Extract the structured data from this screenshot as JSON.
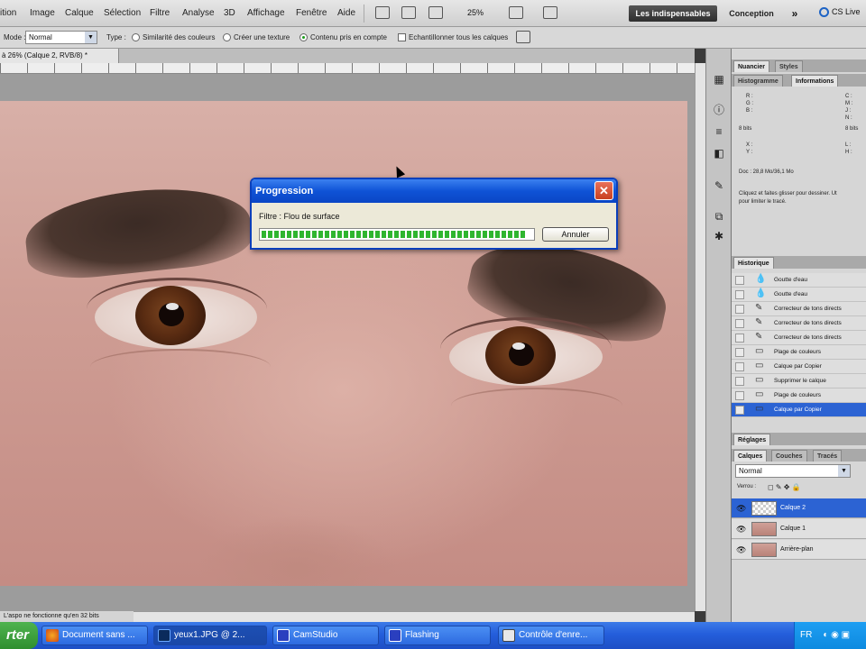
{
  "menu": {
    "items": [
      "ition",
      "Image",
      "Calque",
      "Sélection",
      "Filtre",
      "Analyse",
      "3D",
      "Affichage",
      "Fenêtre",
      "Aide"
    ],
    "zoom": "25%",
    "workspace_active": "Les indispensables",
    "workspace_other": "Conception",
    "more": "»",
    "cslive": "CS Live"
  },
  "options": {
    "mode_label": "Mode :",
    "mode_value": "Normal",
    "type_label": "Type :",
    "radio_1": "Similarité des couleurs",
    "radio_2": "Créer une texture",
    "radio_3": "Contenu pris en compte",
    "sample_all": "Echantillonner tous les calques"
  },
  "document": {
    "tab": "à 26% (Calque 2, RVB/8) *",
    "status": "L'aspo ne fonctionne qu'en 32 bits"
  },
  "dialog": {
    "title": "Progression",
    "close": "✕",
    "filter_label": "Filtre : Flou de surface",
    "progress": 0.98,
    "cancel": "Annuler"
  },
  "panels": {
    "top_tabs": [
      "Nuancier",
      "Styles"
    ],
    "info_tabs": [
      "Histogramme",
      "Informations"
    ],
    "info_lines": {
      "r": "R :",
      "g": "G :",
      "b": "B :",
      "c": "C :",
      "m": "M :",
      "j": "J :",
      "n": "N :",
      "bits_left": "8 bits",
      "bits_right": "8 bits",
      "x": "X :",
      "y": "Y :",
      "l": "L :",
      "h": "H :",
      "doc": "Doc : 28,8 Mo/36,1 Mo",
      "hint_1": "Cliquez et faites glisser pour dessiner. Ut",
      "hint_2": "pour limiter le tracé."
    },
    "history_tab": "Historique",
    "history": [
      "Goutte d'eau",
      "Goutte d'eau",
      "Correcteur de tons directs",
      "Correcteur de tons directs",
      "Correcteur de tons directs",
      "Plage de couleurs",
      "Calque par Copier",
      "Supprimer le calque",
      "Plage de couleurs",
      "Calque par Copier"
    ],
    "adjust_tab": "Réglages",
    "layer_tabs": [
      "Calques",
      "Couches",
      "Tracés"
    ],
    "layer_mode": "Normal",
    "lock_label": "Verrou :",
    "layers": [
      "Calque 2",
      "Calque 1",
      "Arrière-plan"
    ]
  },
  "taskbar": {
    "start": "rter",
    "tasks": [
      "Document sans ...",
      "yeux1.JPG @ 2...",
      "CamStudio",
      "Flashing",
      "Contrôle d'enre..."
    ],
    "lang": "FR"
  },
  "colors": {
    "dialog_blue": "#0f53d6",
    "progress_green": "#2fb52f",
    "selection_blue": "#2c63d3",
    "xp_taskbar": "#245edb"
  }
}
